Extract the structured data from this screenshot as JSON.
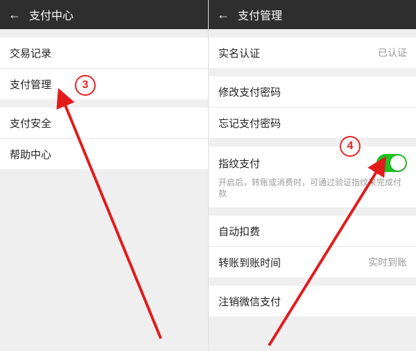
{
  "annotation": {
    "step3_label": "3",
    "step4_label": "4"
  },
  "left": {
    "header": {
      "title": "支付中心"
    },
    "items": {
      "transactions": "交易记录",
      "management": "支付管理",
      "security": "支付安全",
      "help": "帮助中心"
    }
  },
  "right": {
    "header": {
      "title": "支付管理"
    },
    "realname": {
      "label": "实名认证",
      "value": "已认证"
    },
    "change_pwd": {
      "label": "修改支付密码"
    },
    "forgot_pwd": {
      "label": "忘记支付密码"
    },
    "fingerprint": {
      "label": "指纹支付",
      "enabled": true,
      "desc": "开启后，转账或消费时，可通过验证指纹来完成付款"
    },
    "autopay": {
      "label": "自动扣费"
    },
    "arrival": {
      "label": "转账到账时间",
      "value": "实时到账"
    },
    "deregister": {
      "label": "注销微信支付"
    }
  }
}
